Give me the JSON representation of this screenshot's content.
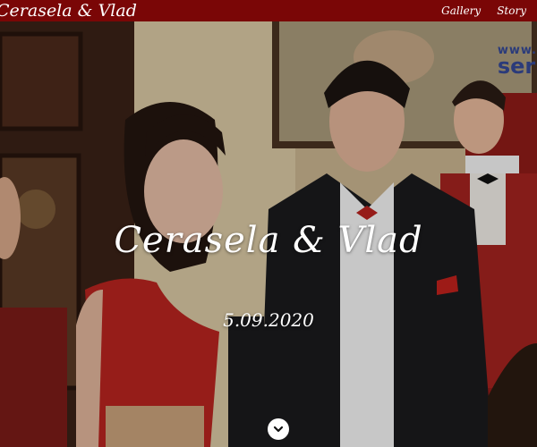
{
  "header": {
    "brand": "Cerasela & Vlad"
  },
  "nav": {
    "items": [
      {
        "label": "Gallery"
      },
      {
        "label": "Story"
      }
    ]
  },
  "hero": {
    "title": "Cerasela & Vlad",
    "date": "5.09.2020",
    "watermark_top": "www.",
    "watermark_bottom": "ser"
  },
  "colors": {
    "bar": "#7a0606",
    "dress": "#b8241f",
    "suit": "#1a1a1d",
    "vest": "#a3231f"
  },
  "icons": {
    "scroll_down": "chevron-down-icon"
  }
}
